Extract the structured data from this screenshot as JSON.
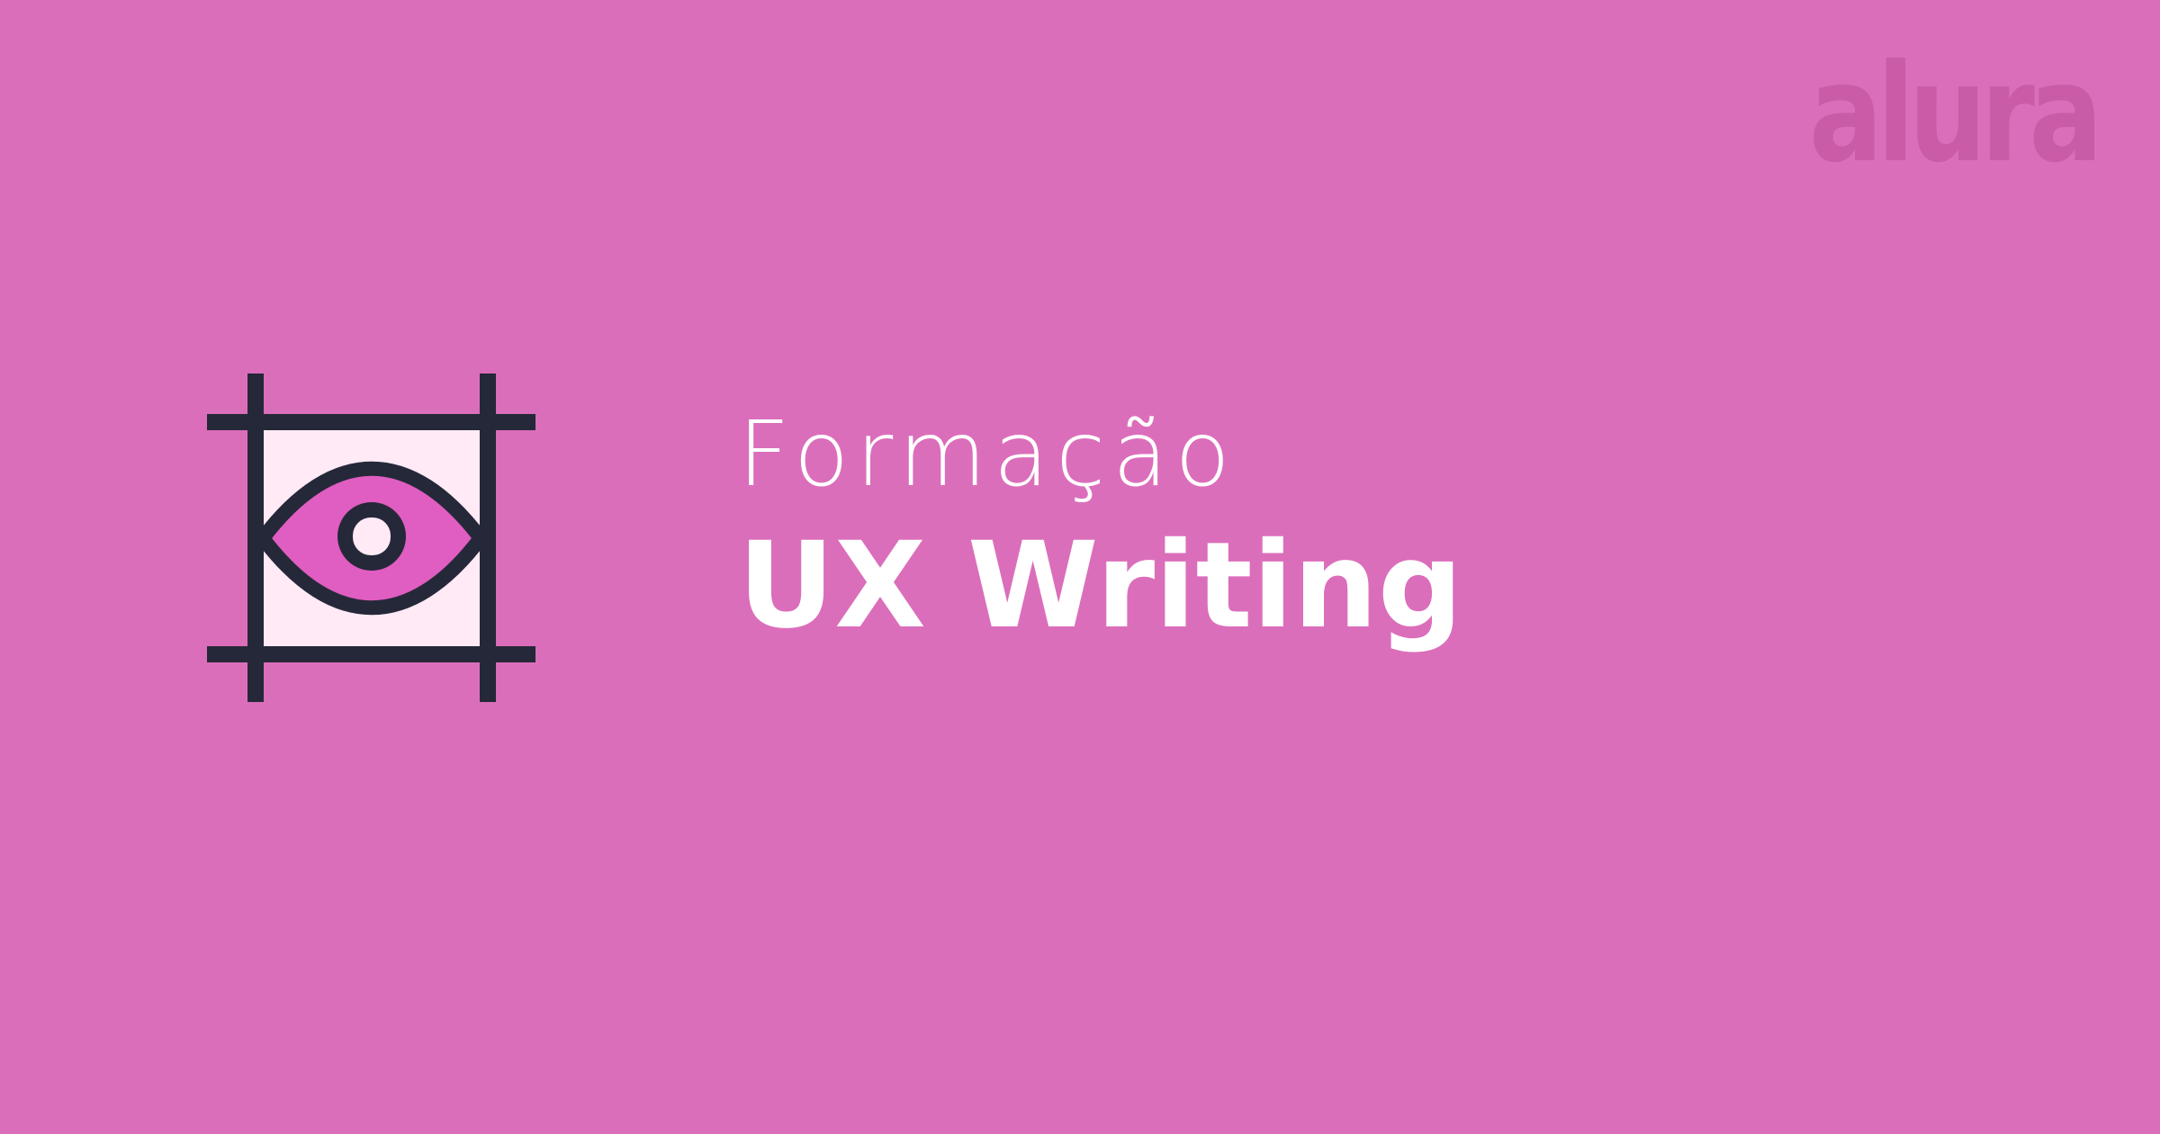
{
  "brand": {
    "logo_text": "alura",
    "logo_icon": "alura-logo",
    "logo_color": "#C95BA7"
  },
  "colors": {
    "background": "#DB6EBA",
    "icon_outline": "#252838",
    "icon_fill": "#FFEAF6",
    "eye_fill": "#E05DC1",
    "text": "#FFFFFF"
  },
  "course": {
    "icon": "eye-frame-icon",
    "label": "Formação",
    "title": "UX Writing"
  }
}
